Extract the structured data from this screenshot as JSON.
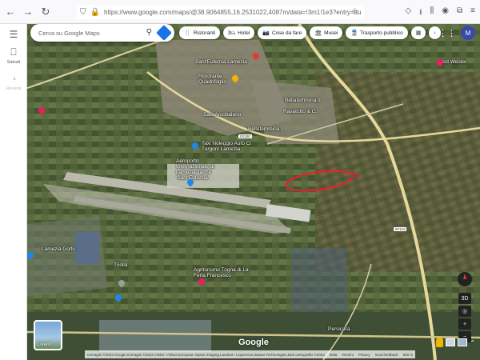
{
  "browser": {
    "url": "https://www.google.com/maps/@38.9064855,16.2531022,4087m/data=!3m1!1e3?entry=ttu"
  },
  "sidebar": {
    "saved_label": "Salvati",
    "recent_label": "Recenti"
  },
  "search": {
    "placeholder": "Cerca su Google Maps"
  },
  "chips": [
    {
      "label": "Ristoranti",
      "icon": "fork-knife-icon"
    },
    {
      "label": "Hotel",
      "icon": "bed-icon"
    },
    {
      "label": "Cose da fare",
      "icon": "camera-icon"
    },
    {
      "label": "Musei",
      "icon": "museum-icon"
    },
    {
      "label": "Trasporto pubblico",
      "icon": "train-icon"
    }
  ],
  "profile_initial": "M",
  "map_labels": {
    "best_western": "Best Wester",
    "sant_eufemia_lamezia": "Sant'Eufemia Lamezia",
    "quadrifoglio": "Ristorante Quadrifoglio",
    "bellafemmina_ii": "Bellafemmina II",
    "rasatutto": "Rasatutto & C.",
    "sala_arcobaleno": "Sala Arcobaleno",
    "bellafemmina_i": "Bellafemmina I",
    "noleggio": "Taxi Noleggio Auto Ci Turgoni Lamezia",
    "aeroporto": "Aeroporto Internazionale di Lamezia Terme 'Sant'Eufemia'",
    "lamezia_golfo": "Lamezia Golfo",
    "trigna": "Agriturismo Trigna di La Ferla Francesco",
    "triolla": "Triolla",
    "persicara": "Persicara"
  },
  "road_shields": {
    "ss280": "SS280",
    "sp": "SP116"
  },
  "layers_label": "Livelli",
  "google_logo": "Google",
  "zoom_level": "3D",
  "attribution": "Immagini ©2023 Google,Immagini ©2023 CNES / Airbus,European Space Imaging,Landsat / Copernicus,Maxar Technologies,Dati cartografici ©2023",
  "attribution_links": [
    "Italia",
    "Termini",
    "Privacy",
    "Invia feedback"
  ],
  "scale": "500 m",
  "colors": {
    "annotation_ellipse": "#e0242a",
    "runway": "#b9b9ae",
    "highway": "#e6d89a",
    "search_accent": "#1a73e8"
  }
}
